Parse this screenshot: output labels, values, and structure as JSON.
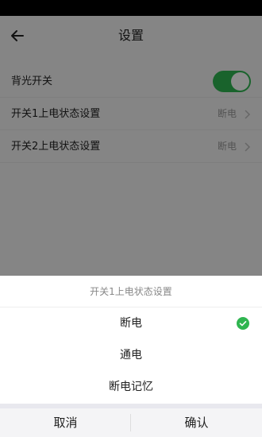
{
  "header": {
    "title": "设置"
  },
  "settings": [
    {
      "label": "背光开关",
      "type": "toggle",
      "enabled": true
    },
    {
      "label": "开关1上电状态设置",
      "value": "断电"
    },
    {
      "label": "开关2上电状态设置",
      "value": "断电"
    }
  ],
  "sheet": {
    "title": "开关1上电状态设置",
    "options": [
      {
        "label": "断电",
        "selected": true
      },
      {
        "label": "通电",
        "selected": false
      },
      {
        "label": "断电记忆",
        "selected": false
      }
    ],
    "cancel_label": "取消",
    "confirm_label": "确认"
  },
  "colors": {
    "accent": "#2fb550",
    "overlay": "rgba(0,0,0,0.45)"
  },
  "icons": {
    "back": "arrow-left-icon",
    "chevron": "chevron-right-icon",
    "check": "check-circle-icon"
  }
}
